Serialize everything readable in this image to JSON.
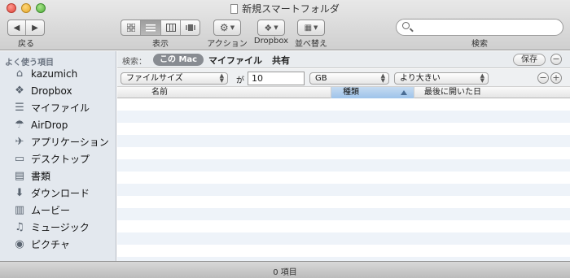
{
  "window": {
    "title": "新規スマートフォルダ"
  },
  "toolbar": {
    "back_label": "戻る",
    "view_label": "表示",
    "action_label": "アクション",
    "dropbox_label": "Dropbox",
    "arrange_label": "並べ替え",
    "search_label": "検索",
    "search_placeholder": ""
  },
  "sidebar": {
    "heading": "よく使う項目",
    "items": [
      {
        "label": "kazumich",
        "icon": "home-icon"
      },
      {
        "label": "Dropbox",
        "icon": "dropbox-icon"
      },
      {
        "label": "マイファイル",
        "icon": "all-my-files-icon"
      },
      {
        "label": "AirDrop",
        "icon": "airdrop-icon"
      },
      {
        "label": "アプリケーション",
        "icon": "applications-icon"
      },
      {
        "label": "デスクトップ",
        "icon": "desktop-icon"
      },
      {
        "label": "書類",
        "icon": "documents-icon"
      },
      {
        "label": "ダウンロード",
        "icon": "downloads-icon"
      },
      {
        "label": "ムービー",
        "icon": "movies-icon"
      },
      {
        "label": "ミュージック",
        "icon": "music-icon"
      },
      {
        "label": "ピクチャ",
        "icon": "pictures-icon"
      }
    ]
  },
  "scope": {
    "label": "検索：",
    "options": [
      "この Mac",
      "マイファイル",
      "共有"
    ],
    "selected": "この Mac",
    "save_label": "保存"
  },
  "criteria": {
    "attribute": "ファイルサイズ",
    "connector": "が",
    "value": "10",
    "unit": "GB",
    "operator": "より大きい"
  },
  "columns": [
    {
      "label": "名前",
      "sorted": false
    },
    {
      "label": "種類",
      "sorted": true
    },
    {
      "label": "最後に開いた日",
      "sorted": false
    }
  ],
  "status": {
    "text": "0 項目"
  }
}
